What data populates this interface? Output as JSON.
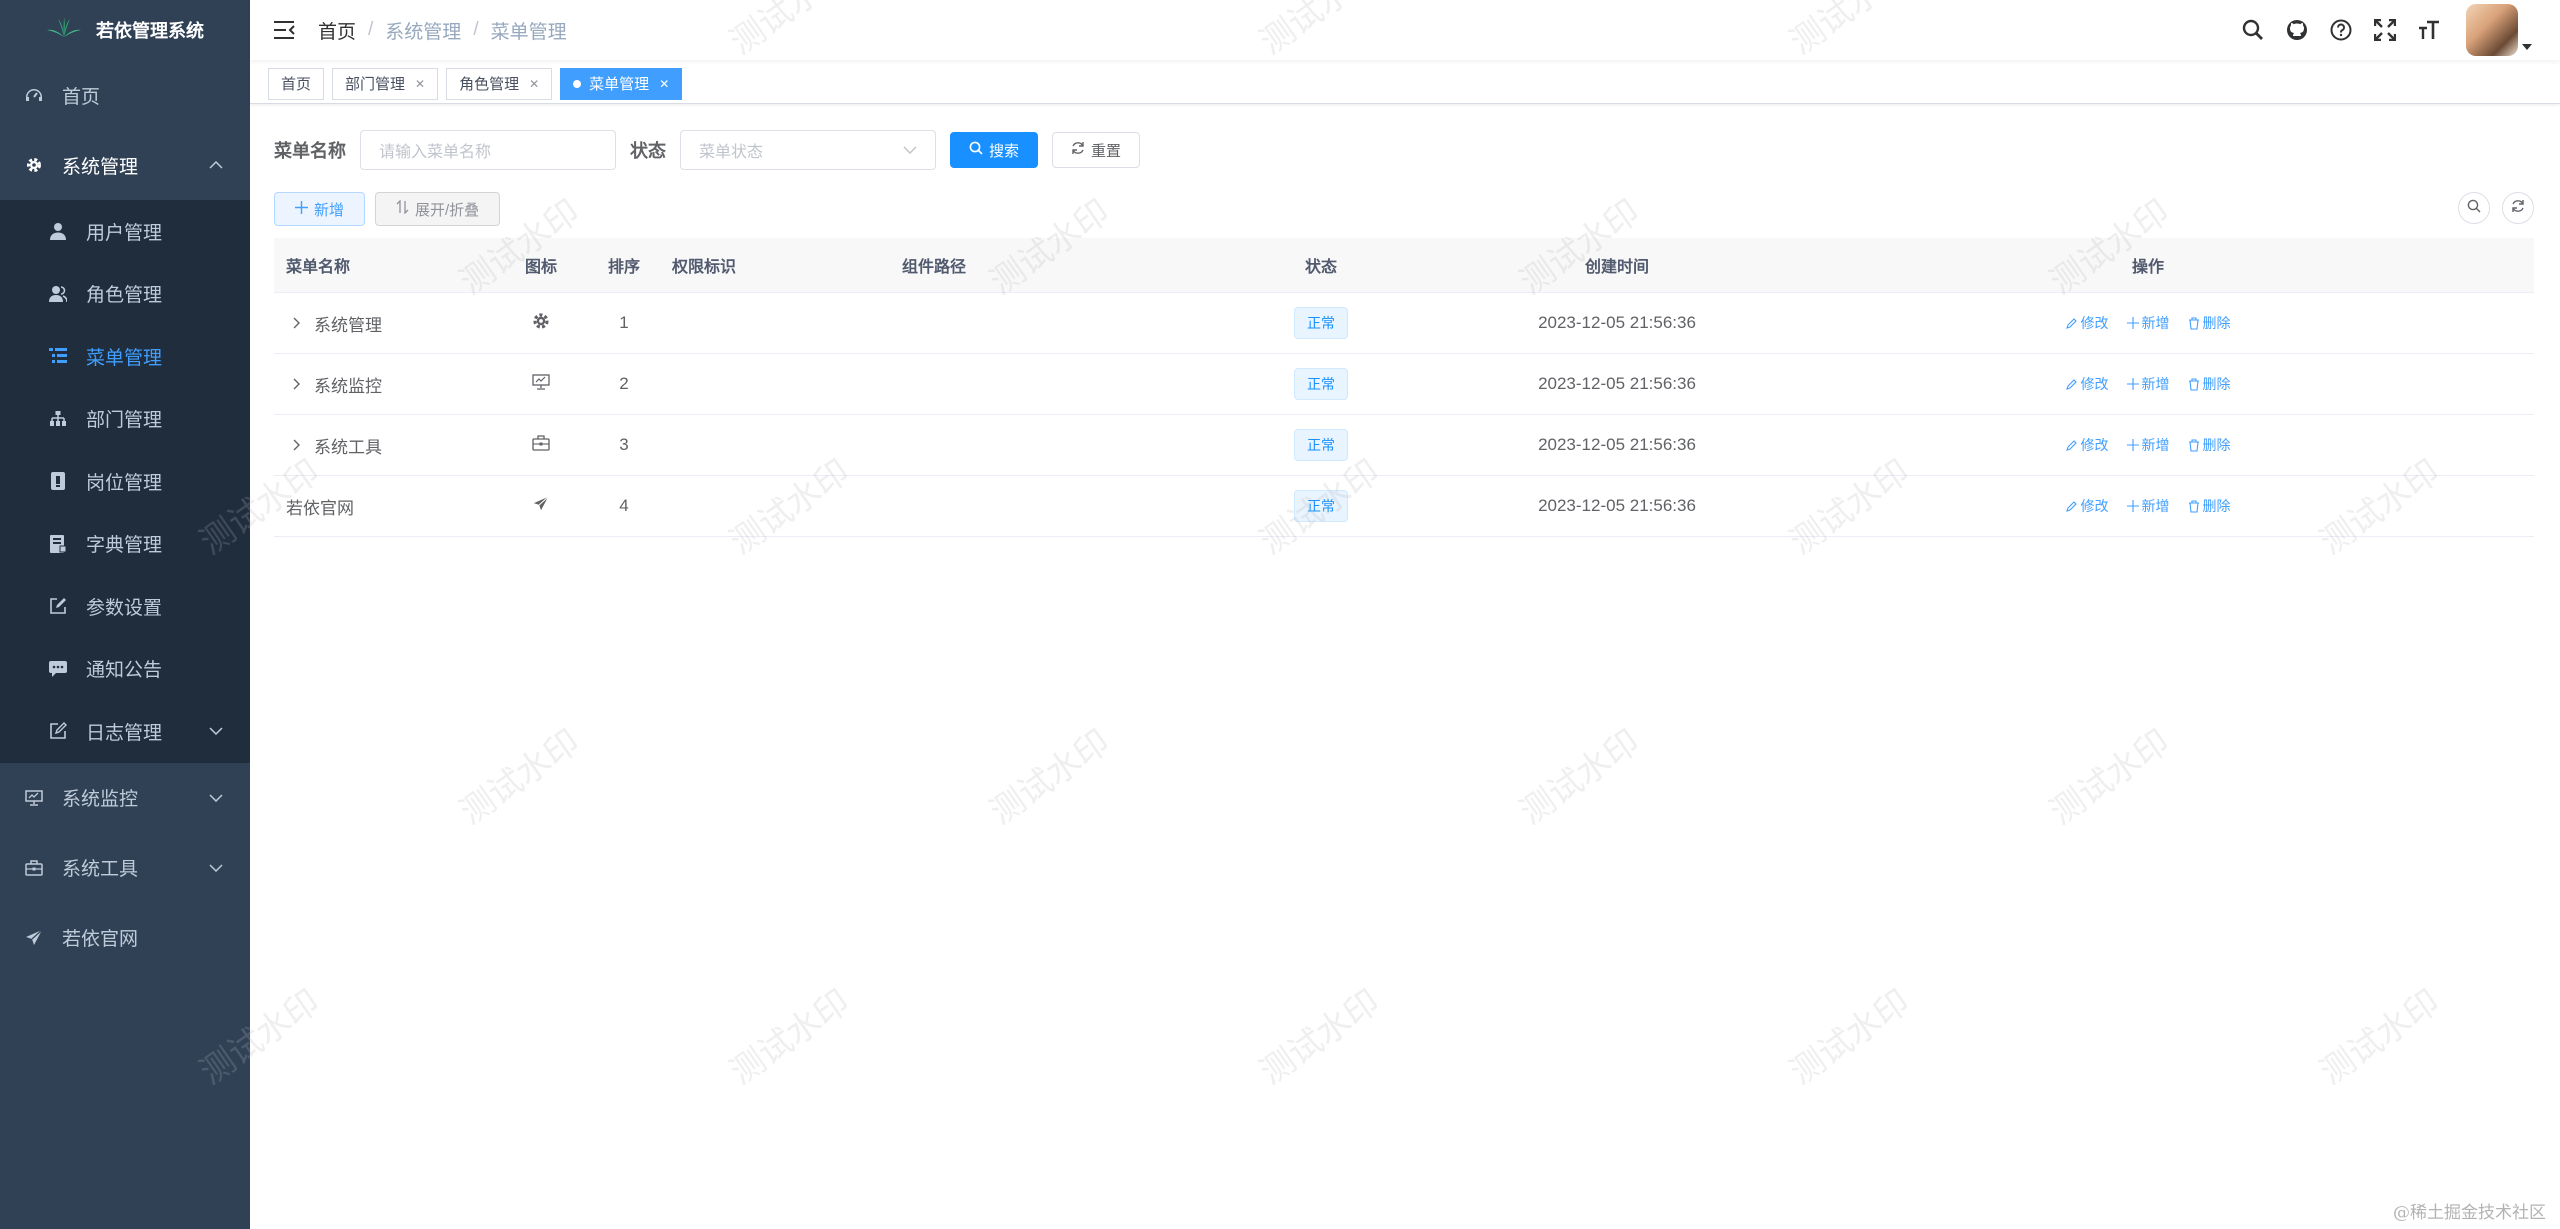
{
  "app": {
    "title": "若依管理系统"
  },
  "sidebar": {
    "items": [
      {
        "label": "首页",
        "icon": "dashboard-icon"
      },
      {
        "label": "系统管理",
        "icon": "gear-icon",
        "expanded": true,
        "children": [
          {
            "label": "用户管理",
            "icon": "user-icon"
          },
          {
            "label": "角色管理",
            "icon": "peoples-icon"
          },
          {
            "label": "菜单管理",
            "icon": "tree-table-icon",
            "active": true
          },
          {
            "label": "部门管理",
            "icon": "tree-icon"
          },
          {
            "label": "岗位管理",
            "icon": "post-icon"
          },
          {
            "label": "字典管理",
            "icon": "dict-icon"
          },
          {
            "label": "参数设置",
            "icon": "edit-icon"
          },
          {
            "label": "通知公告",
            "icon": "message-icon"
          },
          {
            "label": "日志管理",
            "icon": "log-icon"
          }
        ]
      },
      {
        "label": "系统监控",
        "icon": "monitor-icon"
      },
      {
        "label": "系统工具",
        "icon": "tool-icon"
      },
      {
        "label": "若依官网",
        "icon": "guide-icon"
      }
    ]
  },
  "breadcrumb": [
    "首页",
    "系统管理",
    "菜单管理"
  ],
  "tags": [
    {
      "label": "首页",
      "closable": false
    },
    {
      "label": "部门管理",
      "closable": true
    },
    {
      "label": "角色管理",
      "closable": true
    },
    {
      "label": "菜单管理",
      "closable": true,
      "active": true
    }
  ],
  "search": {
    "menu_name_label": "菜单名称",
    "menu_name_placeholder": "请输入菜单名称",
    "status_label": "状态",
    "status_placeholder": "菜单状态",
    "search_button": "搜索",
    "reset_button": "重置"
  },
  "toolbar": {
    "add_button": "新增",
    "expand_button": "展开/折叠"
  },
  "table": {
    "headers": [
      "菜单名称",
      "图标",
      "排序",
      "权限标识",
      "组件路径",
      "状态",
      "创建时间",
      "操作"
    ],
    "rows": [
      {
        "name": "系统管理",
        "icon": "gear-icon",
        "order": "1",
        "perm": "",
        "component": "",
        "status": "正常",
        "time": "2023-12-05 21:56:36",
        "expandable": true
      },
      {
        "name": "系统监控",
        "icon": "monitor-icon",
        "order": "2",
        "perm": "",
        "component": "",
        "status": "正常",
        "time": "2023-12-05 21:56:36",
        "expandable": true
      },
      {
        "name": "系统工具",
        "icon": "tool-icon",
        "order": "3",
        "perm": "",
        "component": "",
        "status": "正常",
        "time": "2023-12-05 21:56:36",
        "expandable": true
      },
      {
        "name": "若依官网",
        "icon": "guide-icon",
        "order": "4",
        "perm": "",
        "component": "",
        "status": "正常",
        "time": "2023-12-05 21:56:36",
        "expandable": false
      }
    ],
    "ops": {
      "edit": "修改",
      "add": "新增",
      "delete": "删除"
    }
  },
  "watermark": {
    "text": "测试水印"
  },
  "footer_watermark": "@稀土掘金技术社区",
  "colors": {
    "sidebar_bg": "#304156",
    "submenu_bg": "#1f2d3d",
    "accent": "#409eff",
    "primary_button": "#1890ff"
  }
}
